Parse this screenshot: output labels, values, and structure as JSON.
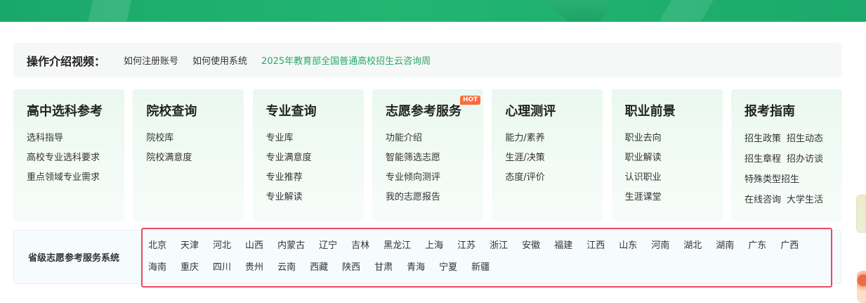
{
  "video_bar": {
    "title": "操作介绍视频：",
    "links": [
      "如何注册账号",
      "如何使用系统",
      "2025年教育部全国普通高校招生云咨询周"
    ]
  },
  "cards": [
    {
      "title": "高中选科参考",
      "links": [
        "选科指导",
        "高校专业选科要求",
        "重点领域专业需求"
      ]
    },
    {
      "title": "院校查询",
      "links": [
        "院校库",
        "院校满意度"
      ]
    },
    {
      "title": "专业查询",
      "links": [
        "专业库",
        "专业满意度",
        "专业推荐",
        "专业解读"
      ]
    },
    {
      "title": "志愿参考服务",
      "badge": "HOT",
      "links": [
        "功能介绍",
        "智能筛选志愿",
        "专业倾向测评",
        "我的志愿报告"
      ]
    },
    {
      "title": "心理测评",
      "links": [
        "能力/素养",
        "生涯/决策",
        "态度/评价"
      ]
    },
    {
      "title": "职业前景",
      "links": [
        "职业去向",
        "职业解读",
        "认识职业",
        "生涯课堂"
      ]
    },
    {
      "title": "报考指南",
      "pairs": [
        [
          "招生政策",
          "招生动态"
        ],
        [
          "招生章程",
          "招办访谈"
        ],
        [
          "特殊类型招生"
        ],
        [
          "在线咨询",
          "大学生活"
        ]
      ]
    }
  ],
  "province": {
    "title": "省级志愿参考服务系统",
    "row1": [
      "北京",
      "天津",
      "河北",
      "山西",
      "内蒙古",
      "辽宁",
      "吉林",
      "黑龙江",
      "上海",
      "江苏",
      "浙江",
      "安徽",
      "福建",
      "江西",
      "山东",
      "河南",
      "湖北",
      "湖南",
      "广东",
      "广西"
    ],
    "row2": [
      "海南",
      "重庆",
      "四川",
      "贵州",
      "云南",
      "西藏",
      "陕西",
      "甘肃",
      "青海",
      "宁夏",
      "新疆"
    ]
  },
  "colors": {
    "brand_green": "#22b572",
    "link_green": "#2aa76a",
    "highlight_border": "#e94a63",
    "hot_badge": "#ff6a3d"
  }
}
